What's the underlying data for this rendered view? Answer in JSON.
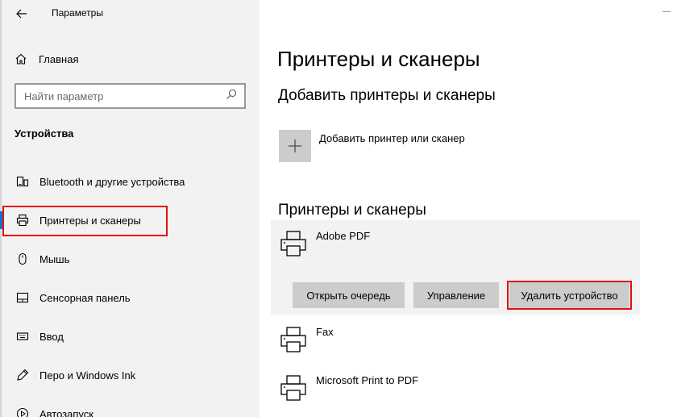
{
  "window": {
    "app_title": "Параметры"
  },
  "sidebar": {
    "home_label": "Главная",
    "search": {
      "placeholder": "Найти параметр"
    },
    "section_header": "Устройства",
    "items": [
      {
        "label": "Bluetooth и другие устройства",
        "icon": "bluetooth-devices-icon"
      },
      {
        "label": "Принтеры и сканеры",
        "icon": "printer-icon",
        "active": true
      },
      {
        "label": "Мышь",
        "icon": "mouse-icon"
      },
      {
        "label": "Сенсорная панель",
        "icon": "touchpad-icon"
      },
      {
        "label": "Ввод",
        "icon": "keyboard-icon"
      },
      {
        "label": "Перо и Windows Ink",
        "icon": "pen-icon"
      },
      {
        "label": "Автозапуск",
        "icon": "autoplay-icon"
      }
    ]
  },
  "main": {
    "title": "Принтеры и сканеры",
    "add_section": {
      "heading": "Добавить принтеры и сканеры",
      "add_label": "Добавить принтер или сканер"
    },
    "printers_section": {
      "heading": "Принтеры и сканеры",
      "printers": [
        {
          "name": "Adobe PDF",
          "selected": true
        },
        {
          "name": "Fax"
        },
        {
          "name": "Microsoft Print to PDF"
        }
      ],
      "actions": {
        "open_queue": "Открыть очередь",
        "manage": "Управление",
        "remove_device": "Удалить устройство"
      }
    }
  },
  "colors": {
    "accent": "#0078d7",
    "highlight": "#e01010",
    "sidebar_bg": "#f2f2f2",
    "button_bg": "#cccccc"
  }
}
